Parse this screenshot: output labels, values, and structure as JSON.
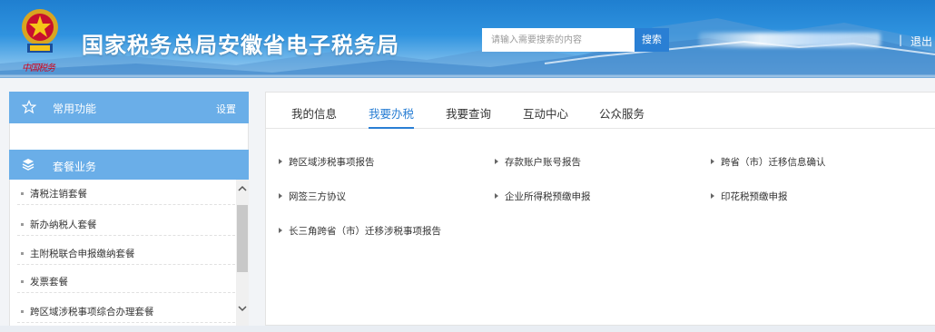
{
  "header": {
    "title": "国家税务总局安徽省电子税务局",
    "brand_sign": "中国税务",
    "search_placeholder": "请输入需要搜索的内容",
    "search_button": "搜索",
    "separator": "|",
    "logout": "退出"
  },
  "sidebar": {
    "common": {
      "label": "常用功能",
      "settings": "设置",
      "icon": "star-outline-icon"
    },
    "package": {
      "label": "套餐业务",
      "icon": "layers-icon"
    },
    "items": [
      {
        "label": "清税注销套餐"
      },
      {
        "label": "新办纳税人套餐"
      },
      {
        "label": "主附税联合申报缴纳套餐"
      },
      {
        "label": "发票套餐"
      },
      {
        "label": "跨区域涉税事项综合办理套餐"
      }
    ]
  },
  "main": {
    "tabs": [
      {
        "label": "我的信息"
      },
      {
        "label": "我要办税",
        "active": true
      },
      {
        "label": "我要查询"
      },
      {
        "label": "互动中心"
      },
      {
        "label": "公众服务"
      }
    ],
    "services": [
      {
        "label": "跨区域涉税事项报告"
      },
      {
        "label": "存款账户账号报告"
      },
      {
        "label": "跨省（市）迁移信息确认"
      },
      {
        "label": "网签三方协议"
      },
      {
        "label": "企业所得税预缴申报"
      },
      {
        "label": "印花税预缴申报"
      },
      {
        "label": "长三角跨省（市）迁移涉税事项报告"
      }
    ]
  },
  "colors": {
    "accent": "#2a7fd4",
    "sidebar_header": "#6aaee8",
    "brand_red": "#d0021b"
  }
}
